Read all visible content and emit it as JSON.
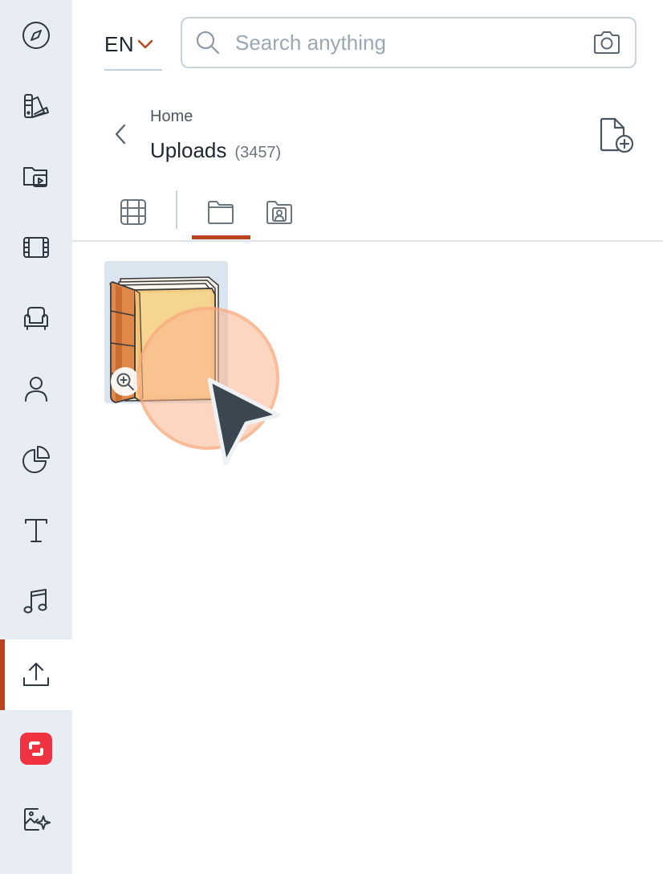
{
  "app": {
    "language": "EN"
  },
  "search": {
    "placeholder": "Search anything"
  },
  "breadcrumb": {
    "parent": "Home",
    "title": "Uploads",
    "count": "(3457)"
  },
  "sidebar": {
    "active_item": "upload",
    "items": [
      {
        "name": "explore",
        "icon": "compass-icon"
      },
      {
        "name": "templates",
        "icon": "palette-icon"
      },
      {
        "name": "media-library",
        "icon": "video-folder-icon"
      },
      {
        "name": "videos",
        "icon": "film-icon"
      },
      {
        "name": "elements",
        "icon": "armchair-icon"
      },
      {
        "name": "characters",
        "icon": "person-icon"
      },
      {
        "name": "charts",
        "icon": "pie-chart-icon"
      },
      {
        "name": "text",
        "icon": "text-icon"
      },
      {
        "name": "music",
        "icon": "music-note-icon"
      },
      {
        "name": "upload",
        "icon": "upload-icon"
      },
      {
        "name": "brand-app",
        "icon": "brand-logo-icon"
      },
      {
        "name": "ai-image",
        "icon": "sparkle-image-icon"
      }
    ]
  },
  "tabs": [
    {
      "name": "videos",
      "icon": "film-grid-icon"
    },
    {
      "name": "folders",
      "icon": "folder-icon",
      "active": true
    },
    {
      "name": "shared-folders",
      "icon": "person-folder-icon"
    }
  ],
  "uploads": {
    "items": [
      {
        "type": "image",
        "subject": "book",
        "icon": "zoom-in-icon"
      }
    ]
  },
  "colors": {
    "accent": "#b9431f",
    "rail_bg": "#e8edf3",
    "brand_red": "#ef3340",
    "cursor_highlight": "#f7b58c"
  }
}
